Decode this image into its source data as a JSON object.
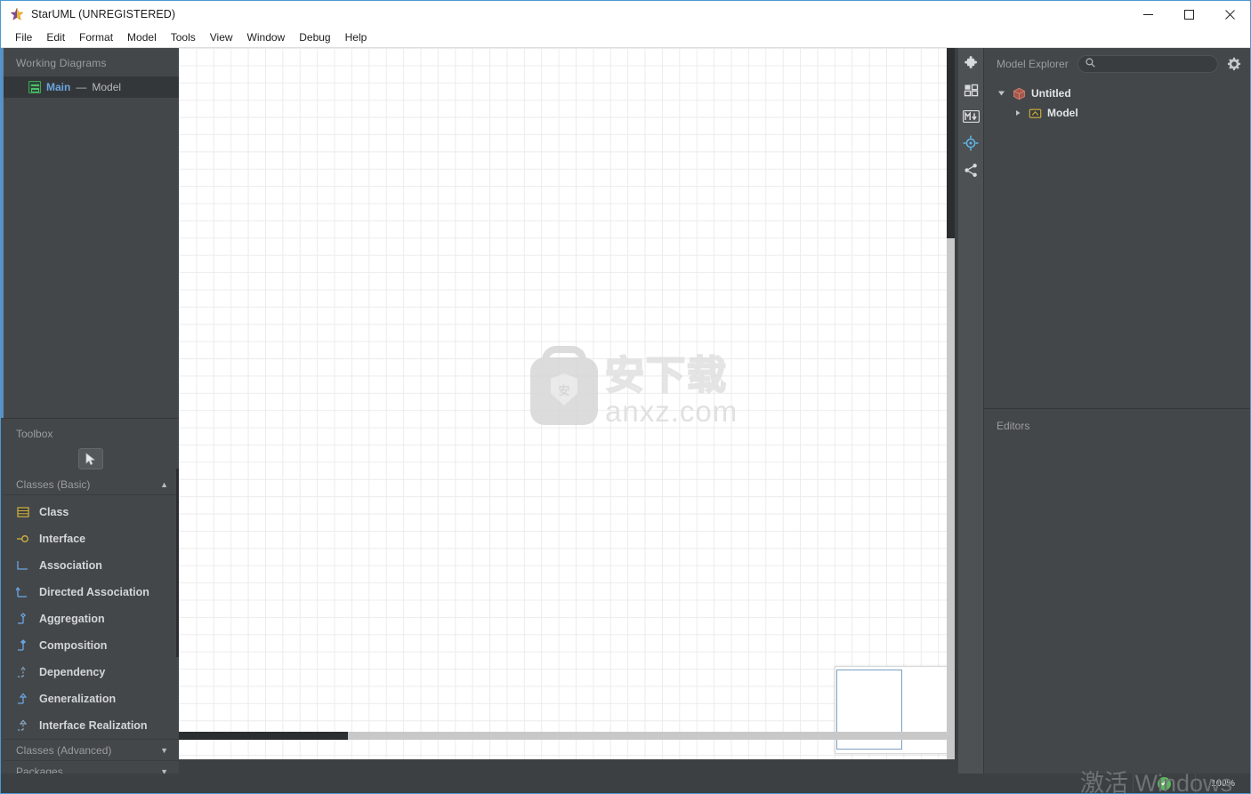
{
  "window": {
    "title": "StarUML (UNREGISTERED)",
    "app_icon": "star-icon",
    "minimize": "—",
    "maximize": "□",
    "close": "✕"
  },
  "menubar": {
    "items": [
      {
        "label": "File"
      },
      {
        "label": "Edit"
      },
      {
        "label": "Format"
      },
      {
        "label": "Model"
      },
      {
        "label": "Tools"
      },
      {
        "label": "View"
      },
      {
        "label": "Window"
      },
      {
        "label": "Debug"
      },
      {
        "label": "Help"
      }
    ]
  },
  "working_diagrams": {
    "title": "Working Diagrams",
    "items": [
      {
        "name": "Main",
        "separator": " — ",
        "owner": "Model",
        "icon": "class-diagram-icon",
        "selected": true
      }
    ]
  },
  "toolbox": {
    "title": "Toolbox",
    "pointer_icon": "cursor-arrow-icon",
    "groups": [
      {
        "label": "Classes (Basic)",
        "expanded": true,
        "caret": "▲",
        "items": [
          {
            "label": "Class",
            "icon": "class-icon"
          },
          {
            "label": "Interface",
            "icon": "interface-icon"
          },
          {
            "label": "Association",
            "icon": "association-icon"
          },
          {
            "label": "Directed Association",
            "icon": "directed-association-icon"
          },
          {
            "label": "Aggregation",
            "icon": "aggregation-icon"
          },
          {
            "label": "Composition",
            "icon": "composition-icon"
          },
          {
            "label": "Dependency",
            "icon": "dependency-icon"
          },
          {
            "label": "Generalization",
            "icon": "generalization-icon"
          },
          {
            "label": "Interface Realization",
            "icon": "interface-realization-icon"
          }
        ]
      },
      {
        "label": "Classes (Advanced)",
        "expanded": false,
        "caret": "▼",
        "items": []
      },
      {
        "label": "Packages",
        "expanded": false,
        "caret": "▼",
        "items": []
      }
    ]
  },
  "rail": {
    "buttons": [
      {
        "name": "extension-manager-icon",
        "label": "Extension Manager",
        "active": false
      },
      {
        "name": "grid-apps-icon",
        "label": "Diagrams",
        "active": false
      },
      {
        "name": "markdown-icon",
        "label": "Markdown",
        "active": false,
        "text": "M"
      },
      {
        "name": "target-crosshair-icon",
        "label": "Locate",
        "active": true
      },
      {
        "name": "share-network-icon",
        "label": "Share",
        "active": false
      }
    ]
  },
  "canvas": {
    "watermark": {
      "cn_text": "安下载",
      "shield_char": "安",
      "url_text": "anxz.com"
    },
    "minimap": {
      "label": "minimap"
    }
  },
  "model_explorer": {
    "title": "Model Explorer",
    "search": {
      "placeholder": "",
      "value": "",
      "icon": "search-icon"
    },
    "settings_icon": "gear-icon",
    "tree": [
      {
        "label": "Untitled",
        "icon": "project-icon",
        "expanded": true,
        "triangle": "◢",
        "depth": 0
      },
      {
        "label": "Model",
        "icon": "model-folder-icon",
        "expanded": false,
        "triangle": "▸",
        "depth": 1
      }
    ]
  },
  "editors": {
    "title": "Editors"
  },
  "statusbar": {
    "status_icon": "green-check-icon",
    "check_glyph": "✓",
    "zoom_level": "100%",
    "activation_watermark": "激活 Windows"
  },
  "colors": {
    "panel_bg": "#44474a",
    "canvas_bg": "#ffffff",
    "accent_blue": "#6aa5e0",
    "selected_row": "#343739",
    "grid_line": "#ececec",
    "tool_yellow": "#d4b43c",
    "tool_blue": "#6aa5e0",
    "green_check": "#5cb85c"
  }
}
